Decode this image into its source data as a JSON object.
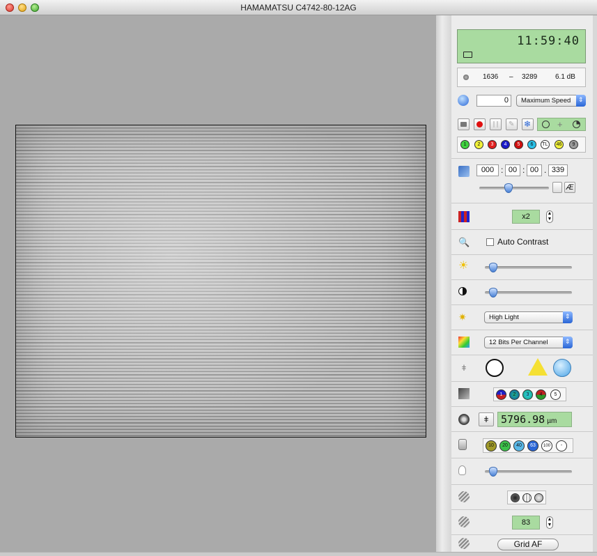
{
  "window": {
    "title": "HAMAMATSU C4742-80-12AG"
  },
  "status": {
    "time": "11:59:40"
  },
  "levels": {
    "low": "1636",
    "sep": "–",
    "high": "3289",
    "gain": "6.1 dB"
  },
  "speed": {
    "value": "0",
    "mode": "Maximum Speed"
  },
  "channels": [
    "1",
    "2",
    "3",
    "4",
    "5",
    "6",
    "TL",
    "46",
    "9"
  ],
  "exposure": {
    "h": "000",
    "m": "00",
    "s": "00",
    "ms": "339",
    "sep1": ":",
    "sep2": ":",
    "sep3": "."
  },
  "binning": {
    "value": "x2"
  },
  "contrast": {
    "label": "Auto Contrast",
    "checked": false
  },
  "brightness_level": 0.05,
  "gamma_level": 0.05,
  "illumination": {
    "mode": "High Light"
  },
  "bitdepth": {
    "mode": "12 Bits Per Channel"
  },
  "filters": [
    "1",
    "2",
    "3",
    "4",
    "5"
  ],
  "stage": {
    "position": "5796.98",
    "unit": "µm"
  },
  "objectives": [
    "10",
    "20",
    "40",
    "63",
    "100",
    "-"
  ],
  "lamp_level": 0.05,
  "shutter": {
    "value": "83"
  },
  "autofocus": {
    "label": "Grid AF"
  },
  "colors": {
    "lcd": "#a9dba0",
    "viewer": "#aaaaaa",
    "accent": "#2a66d6"
  }
}
